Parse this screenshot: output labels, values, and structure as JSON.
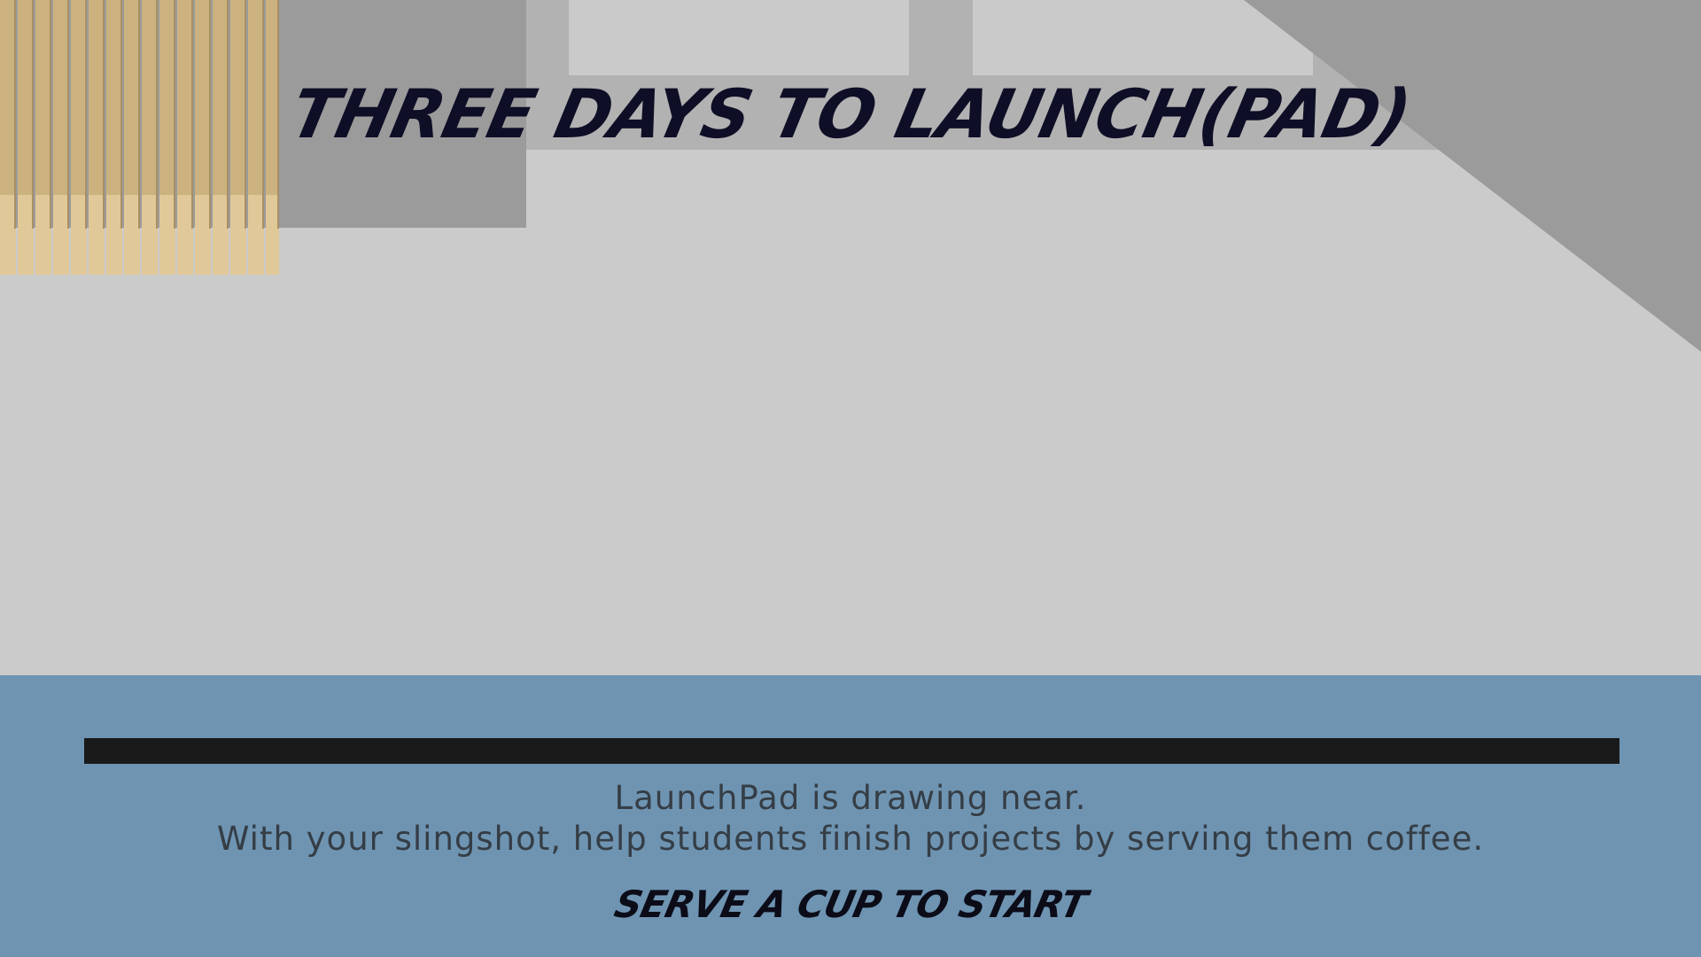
{
  "game": {
    "title": "THREE DAYS TO LAUNCH(PAD)",
    "description_lines": [
      "LaunchPad is drawing near.",
      "With your slingshot, help students finish projects by serving them coffee."
    ],
    "start_prompt": "SERVE A CUP TO START",
    "progress": 0
  },
  "colors": {
    "wall": "#cbcbcb",
    "wall_dark": "#9b9b9b",
    "blinds": "#d4b986",
    "hud_background": "#6e94b2",
    "progress_track": "#1a1a1a",
    "title_text": "#0e0e26",
    "body_text": "#353d45"
  },
  "icons": {
    "blinds": "window-blinds-icon"
  }
}
